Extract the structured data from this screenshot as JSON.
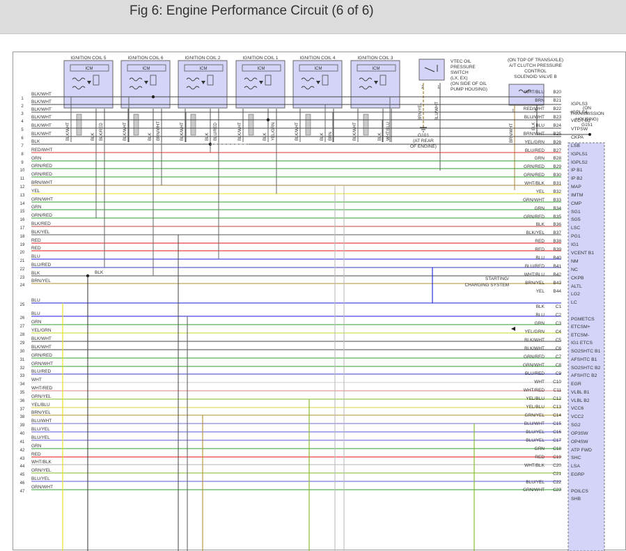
{
  "title": "Fig 6: Engine Performance Circuit (6 of 6)",
  "colors": {
    "header_bg": "#dcdcdc",
    "connector_fill": "#d4d4f8",
    "wire_default": "#555555"
  },
  "coils": [
    {
      "label": "IGNITION COIL 5",
      "icm": "ICM",
      "wires": [
        "BLK/WHT",
        "BLK",
        "BLK/RED"
      ]
    },
    {
      "label": "IGNITION COIL 6",
      "icm": "ICM",
      "wires": [
        "BLK/WHT",
        "BLK",
        "BRN/WHT"
      ]
    },
    {
      "label": "IGNITION COIL 2",
      "icm": "ICM",
      "wires": [
        "BLK/WHT",
        "BLK",
        "BLU/RED"
      ]
    },
    {
      "label": "IGNITION COIL 1",
      "icm": "ICM",
      "wires": [
        "BLK/WHT",
        "BLK",
        "YEL/GRN"
      ]
    },
    {
      "label": "IGNITION COIL 4",
      "icm": "ICM",
      "wires": [
        "BLK/WHT",
        "BLK",
        "BRN"
      ]
    },
    {
      "label": "IGNITION COIL 3",
      "icm": "ICM",
      "wires": [
        "BLK/WHT",
        "BLK",
        "WHT/BLU"
      ]
    }
  ],
  "vtec": {
    "lines": [
      "VTEC OIL",
      "PRESSURE",
      "SWITCH",
      "(LX, EX)",
      "(ON SIDE OF OIL",
      "PUMP HOUSING)"
    ],
    "pins": [
      "2",
      "1"
    ],
    "wires": [
      "BRN/YEL",
      "BLU/WHT"
    ],
    "ground": "G101",
    "ground_note": [
      "(AT REAR",
      "OF ENGINE)"
    ]
  },
  "solenoid": {
    "lines": [
      "(ON TOP OF TRANSAXLE)",
      "A/T CLUTCH PRESSURE",
      "CONTROL",
      "SOLENOID VALVE B"
    ],
    "pins": [
      "1",
      "2"
    ],
    "wires": [
      "BRN/WHT",
      "BLK"
    ],
    "ground_note": [
      "(ON",
      "TRANSMISSION",
      "HOUSING)"
    ],
    "ground": "G151"
  },
  "starting": [
    "STARTING/",
    "CHARGING SYSTEM"
  ],
  "left_rows": [
    {
      "n": "1",
      "t": "BLK/WHT"
    },
    {
      "n": "2",
      "t": "BLK/WHT"
    },
    {
      "n": "3",
      "t": "BLK/WHT"
    },
    {
      "n": "4",
      "t": "BLK/WHT"
    },
    {
      "n": "5",
      "t": "BLK/WHT"
    },
    {
      "n": "6",
      "t": "BLK/WHT"
    },
    {
      "n": "7",
      "t": "BLK"
    },
    {
      "n": "8",
      "t": "RED/WHT"
    },
    {
      "n": "9",
      "t": "GRN"
    },
    {
      "n": "10",
      "t": "GRN/RED"
    },
    {
      "n": "11",
      "t": "GRN/RED"
    },
    {
      "n": "12",
      "t": "BRN/WHT"
    },
    {
      "n": "13",
      "t": "YEL"
    },
    {
      "n": "14",
      "t": "GRN/WHT"
    },
    {
      "n": "15",
      "t": "GRN"
    },
    {
      "n": "16",
      "t": "GRN/RED"
    },
    {
      "n": "17",
      "t": "BLK/RED"
    },
    {
      "n": "18",
      "t": "BLK/YEL"
    },
    {
      "n": "19",
      "t": "RED"
    },
    {
      "n": "20",
      "t": "RED"
    },
    {
      "n": "21",
      "t": "BLU"
    },
    {
      "n": "22",
      "t": "BLU/RED"
    },
    {
      "n": "23",
      "t": "BLK"
    },
    {
      "n": "24",
      "t": "BRN/YEL"
    },
    {
      "n": "25",
      "t": "BLU"
    },
    {
      "n": "26",
      "t": "BLU"
    },
    {
      "n": "27",
      "t": "GRN"
    },
    {
      "n": "28",
      "t": "YEL/GRN"
    },
    {
      "n": "29",
      "t": "BLK/WHT"
    },
    {
      "n": "30",
      "t": "BLK/WHT"
    },
    {
      "n": "31",
      "t": "GRN/RED"
    },
    {
      "n": "32",
      "t": "GRN/WHT"
    },
    {
      "n": "33",
      "t": "BLU/RED"
    },
    {
      "n": "34",
      "t": "WHT"
    },
    {
      "n": "35",
      "t": "WHT/RED"
    },
    {
      "n": "36",
      "t": "GRN/YEL"
    },
    {
      "n": "37",
      "t": "YEL/BLU"
    },
    {
      "n": "38",
      "t": "BRN/YEL"
    },
    {
      "n": "39",
      "t": "BLU/WHT"
    },
    {
      "n": "40",
      "t": "BLU/YEL"
    },
    {
      "n": "41",
      "t": "BLU/YEL"
    },
    {
      "n": "42",
      "t": "GRN"
    },
    {
      "n": "43",
      "t": "RED"
    },
    {
      "n": "44",
      "t": "WHT/BLK"
    },
    {
      "n": "45",
      "t": "GRN/YEL"
    },
    {
      "n": "46",
      "t": "BLU/YEL"
    },
    {
      "n": "47",
      "t": "GRN/WHT"
    }
  ],
  "right_rows": [
    {
      "w": "WHT/BLU",
      "p": "B20"
    },
    {
      "w": "BRN",
      "p": "B21"
    },
    {
      "w": "RED/WHT",
      "p": "B22"
    },
    {
      "w": "BLU/WHT",
      "p": "B23"
    },
    {
      "w": "BLU",
      "p": "B24"
    },
    {
      "w": "BRN/WHT",
      "p": "B25"
    },
    {
      "w": "YEL/GRN",
      "p": "B26"
    },
    {
      "w": "BLU/RED",
      "p": "B27"
    },
    {
      "w": "GRN",
      "p": "B28"
    },
    {
      "w": "GRN/RED",
      "p": "B29"
    },
    {
      "w": "GRN/RED",
      "p": "B30"
    },
    {
      "w": "WHT/BLK",
      "p": "B31"
    },
    {
      "w": "YEL",
      "p": "B32"
    },
    {
      "w": "GRN/WHT",
      "p": "B33"
    },
    {
      "w": "GRN",
      "p": "B34"
    },
    {
      "w": "GRN/RED",
      "p": "B35"
    },
    {
      "w": "BLK",
      "p": "B36"
    },
    {
      "w": "BLK/YEL",
      "p": "B37"
    },
    {
      "w": "RED",
      "p": "B38"
    },
    {
      "w": "RED",
      "p": "B39"
    },
    {
      "w": "BLU",
      "p": "B40"
    },
    {
      "w": "BLU/RED",
      "p": "B41"
    },
    {
      "w": "WHT/BLU",
      "p": "B42"
    },
    {
      "w": "BRN/YEL",
      "p": "B43"
    },
    {
      "w": "YEL",
      "p": "B44"
    },
    {
      "w": "BLK",
      "p": "C1"
    },
    {
      "w": "BLU",
      "p": "C2"
    },
    {
      "w": "GRN",
      "p": "C3"
    },
    {
      "w": "YEL/GRN",
      "p": "C4"
    },
    {
      "w": "BLK/WHT",
      "p": "C5"
    },
    {
      "w": "BLK/WHT",
      "p": "C6"
    },
    {
      "w": "GRN/RED",
      "p": "C7"
    },
    {
      "w": "GRN/WHT",
      "p": "C8"
    },
    {
      "w": "BLU/RED",
      "p": "C9"
    },
    {
      "w": "WHT",
      "p": "C10"
    },
    {
      "w": "WHT/RED",
      "p": "C11"
    },
    {
      "w": "YEL/BLU",
      "p": "C12"
    },
    {
      "w": "YEL/BLU",
      "p": "C13"
    },
    {
      "w": "GRN/YEL",
      "p": "C14"
    },
    {
      "w": "BLU/WHT",
      "p": "C15"
    },
    {
      "w": "BLU/YEL",
      "p": "C16"
    },
    {
      "w": "BLU/YEL",
      "p": "C17"
    },
    {
      "w": "GRN",
      "p": "C18"
    },
    {
      "w": "RED",
      "p": "C19"
    },
    {
      "w": "WHT/BLK",
      "p": "C20"
    },
    {
      "w": "",
      "p": "C21"
    },
    {
      "w": "BLU/YEL",
      "p": "C22"
    },
    {
      "w": "GRN/WHT",
      "p": "C23"
    }
  ],
  "signals": [
    "IGPLS3",
    "IGPLS4",
    "VECT B2",
    "VTPSW",
    "CKPA",
    "LSB",
    "IGPLS1",
    "IGPLS2",
    "IP B1",
    "IP B2",
    "MAP",
    "IMTM",
    "CMP",
    "SG1",
    "SG5",
    "LSC",
    "PG1",
    "IG1",
    "VCENT B1",
    "NM",
    "NC",
    "CKPB",
    "ALTL",
    "LG2",
    "LC",
    "PGMETCS",
    "ETCSM+",
    "ETCSM-",
    "IG1 ETCS",
    "SO2SHTC B1",
    "AFSHTC B1",
    "SO2SHTC B2",
    "AFSHTC B2",
    "EGR",
    "VLBL B1",
    "VLBL B2",
    "VCC6",
    "VCC2",
    "SG2",
    "OP3SW",
    "OP4SW",
    "ATP FWD",
    "SHC",
    "LSA",
    "EGRP",
    "POILCS",
    "SHB"
  ],
  "mid_labels": [
    "BLK"
  ]
}
